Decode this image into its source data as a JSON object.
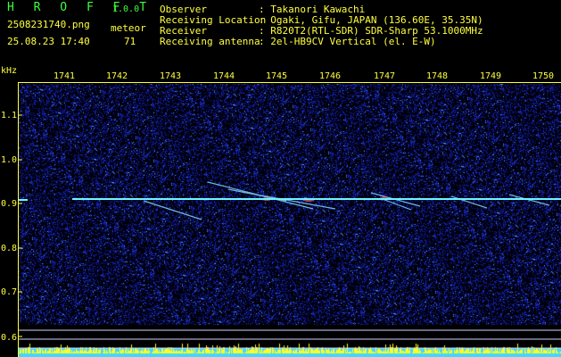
{
  "header": {
    "app_name": "H R O F F T",
    "version": "1.0.0",
    "filename": "2508231740.png",
    "datetime": "25.08.23 17:40",
    "meteor_label": "meteor",
    "meteor_count": "71",
    "fields": [
      {
        "label": "Observer",
        "value": ": Takanori Kawachi"
      },
      {
        "label": "Receiving Location",
        "value": ": Ogaki, Gifu, JAPAN (136.60E, 35.35N)"
      },
      {
        "label": "Receiver",
        "value": ": R820T2(RTL-SDR) SDR-Sharp 53.1000MHz"
      },
      {
        "label": "Receiving antenna",
        "value": ": 2el-HB9CV Vertical (el. E-W)"
      }
    ]
  },
  "axes": {
    "y_unit": "kHz",
    "x_ticks": [
      "1741",
      "1742",
      "1743",
      "1744",
      "1745",
      "1746",
      "1747",
      "1748",
      "1749",
      "1750"
    ],
    "y_ticks": [
      "1.1",
      "1.0",
      "0.9",
      "0.8",
      "0.7",
      "0.6"
    ]
  },
  "colors": {
    "text_yellow": "#ffff40",
    "text_green": "#3cff3c",
    "text_cyan": "#40ffff",
    "noise_blue": "#1a2dbf",
    "carrier_cyan": "#60e0ff",
    "level_yellow": "#ffff20"
  }
}
